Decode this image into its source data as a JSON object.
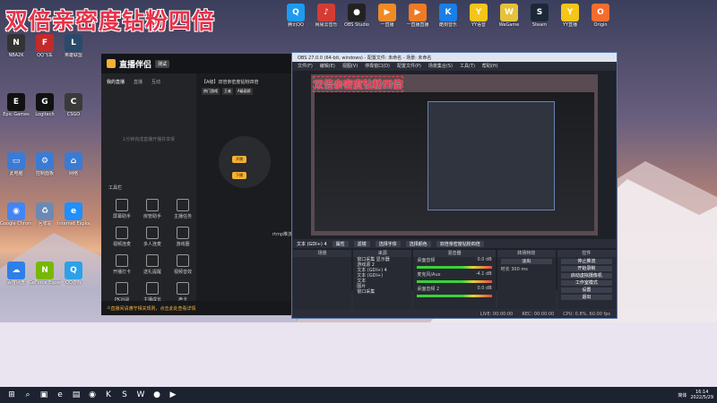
{
  "overlay_title": "双倍亲密度钻粉四倍",
  "desktop_icons_top": [
    {
      "label": "腾讯QQ",
      "icon": "qq-icon",
      "color": "#1d9bf0",
      "glyph": "Q"
    },
    {
      "label": "网易云音乐",
      "icon": "netease-music-icon",
      "color": "#d43c33",
      "glyph": "♪"
    },
    {
      "label": "OBS Studio",
      "icon": "obs-icon",
      "color": "#222",
      "glyph": "●"
    },
    {
      "label": "一直播",
      "icon": "yizhibo-icon",
      "color": "#f08a24",
      "glyph": "▶"
    },
    {
      "label": "一直播直播",
      "icon": "yizhibo-live-icon",
      "color": "#f07a24",
      "glyph": "▶"
    },
    {
      "label": "酷狗音乐",
      "icon": "kugou-icon",
      "color": "#1a7ee6",
      "glyph": "K"
    },
    {
      "label": "YY语音",
      "icon": "yy-icon",
      "color": "#f5c518",
      "glyph": "Y"
    },
    {
      "label": "WeGame",
      "icon": "wegame-icon",
      "color": "#e6c13a",
      "glyph": "W"
    },
    {
      "label": "Steam",
      "icon": "steam-icon",
      "color": "#1b2838",
      "glyph": "S"
    },
    {
      "label": "YY直播",
      "icon": "yylive-icon",
      "color": "#f5c518",
      "glyph": "Y"
    },
    {
      "label": "Origin",
      "icon": "origin-icon",
      "color": "#f56c2d",
      "glyph": "O"
    }
  ],
  "desktop_icons_left": [
    {
      "label": "NBA2K",
      "icon": "nba-icon",
      "color": "#333",
      "glyph": "N"
    },
    {
      "label": "QQ飞车",
      "icon": "qqspeed-icon",
      "color": "#c32a2a",
      "glyph": "F"
    },
    {
      "label": "英雄联盟",
      "icon": "lol-icon",
      "color": "#2a4a6a",
      "glyph": "L"
    },
    {
      "label": "Epic Games",
      "icon": "epic-icon",
      "color": "#111",
      "glyph": "E"
    },
    {
      "label": "Logitech",
      "icon": "logitech-icon",
      "color": "#111",
      "glyph": "G"
    },
    {
      "label": "CSGO",
      "icon": "csgo-icon",
      "color": "#3a3a3a",
      "glyph": "C"
    },
    {
      "label": "此电脑",
      "icon": "computer-icon",
      "color": "#3a7bd5",
      "glyph": "▭"
    },
    {
      "label": "控制面板",
      "icon": "control-panel-icon",
      "color": "#3a7bd5",
      "glyph": "⚙"
    },
    {
      "label": "网络",
      "icon": "network-icon",
      "color": "#3a7bd5",
      "glyph": "⌂"
    },
    {
      "label": "Google Chrome",
      "icon": "chrome-icon",
      "color": "#4285f4",
      "glyph": "◉"
    },
    {
      "label": "回收站",
      "icon": "recycle-bin-icon",
      "color": "#6a8ab5",
      "glyph": "♻"
    },
    {
      "label": "Internet Explorer",
      "icon": "ie-icon",
      "color": "#1e90ff",
      "glyph": "e"
    },
    {
      "label": "百度网盘",
      "icon": "baidu-pan-icon",
      "color": "#2f7fe8",
      "glyph": "☁"
    },
    {
      "label": "GeForce Experience",
      "icon": "geforce-icon",
      "color": "#76b900",
      "glyph": "N"
    },
    {
      "label": "QQ游戏",
      "icon": "qqgame-icon",
      "color": "#2da1e8",
      "glyph": "Q"
    }
  ],
  "live_app": {
    "logo": "直播伴侣",
    "badge": "测试",
    "tabs": [
      "我的直播",
      "直播",
      "互动"
    ],
    "empty_hint": "1分钟完成直播开播并享受",
    "tools_title": "工具栏",
    "tools": [
      "屏幕助手",
      "房管助手",
      "主播任务",
      "视频连麦",
      "多人连麦",
      "游戏圈",
      "开播打卡",
      "送礼提醒",
      "视频音效",
      "PK对战",
      "主播成长",
      "声卡"
    ],
    "footer_notice": "直播间请遵守相关规则，点击此处查看详情",
    "start_btn": "开播",
    "stop_btn": "下播",
    "rtmp_label": "rtmp推流",
    "main_title": "【A级】双倍亲密度钻粉四倍",
    "main_subtabs": [
      "热门游戏",
      "王者",
      "A级画质"
    ]
  },
  "obs": {
    "title": "OBS 27.0.0 (64-bit, windows) - 配置文件: 未命名 - 场景: 未命名",
    "menu": [
      "文件(F)",
      "编辑(E)",
      "视图(V)",
      "停靠窗口(D)",
      "配置文件(P)",
      "场景集合(S)",
      "工具(T)",
      "帮助(H)"
    ],
    "source_bar": {
      "label": "文本 (GDI+) 4",
      "props": "属性",
      "filters": "滤镜",
      "select_font": "选择字体",
      "select_color": "选择颜色",
      "text": "双倍亲密度钻粉四倍"
    },
    "docks": {
      "scenes": "场景",
      "sources": "来源",
      "mixer": "混音器",
      "transitions": "转场特效",
      "controls": "控件"
    },
    "sources_list": [
      "窗口采集 显示器",
      "游戏源 2",
      "文本 (GDI+) 4",
      "文本 (GDI+)",
      "文本",
      "图片",
      "窗口采集"
    ],
    "mixer_tracks": [
      {
        "name": "桌面音频",
        "db": "0.0 dB"
      },
      {
        "name": "麦克风/Aux",
        "db": "-4.1 dB"
      },
      {
        "name": "桌面音频 2",
        "db": "0.0 dB"
      }
    ],
    "transition": {
      "label": "淡出",
      "duration_label": "时长",
      "duration": "300 ms"
    },
    "controls": [
      "停止推流",
      "开始录制",
      "启动虚拟摄像机",
      "工作室模式",
      "设置",
      "退出"
    ],
    "status": [
      "LIVE: 00:00:00",
      "REC: 00:00:00",
      "CPU: 0.8%, 60.00 fps"
    ]
  },
  "taskbar": {
    "icons": [
      "windows-start-icon",
      "search-icon",
      "task-view-icon",
      "edge-icon",
      "explorer-icon",
      "chrome-icon",
      "kugou-icon",
      "steam-icon",
      "wegame-icon",
      "obs-icon",
      "yizhibo-icon"
    ],
    "tray_lang": "简体",
    "time": "16:14",
    "date": "2022/5/29"
  }
}
